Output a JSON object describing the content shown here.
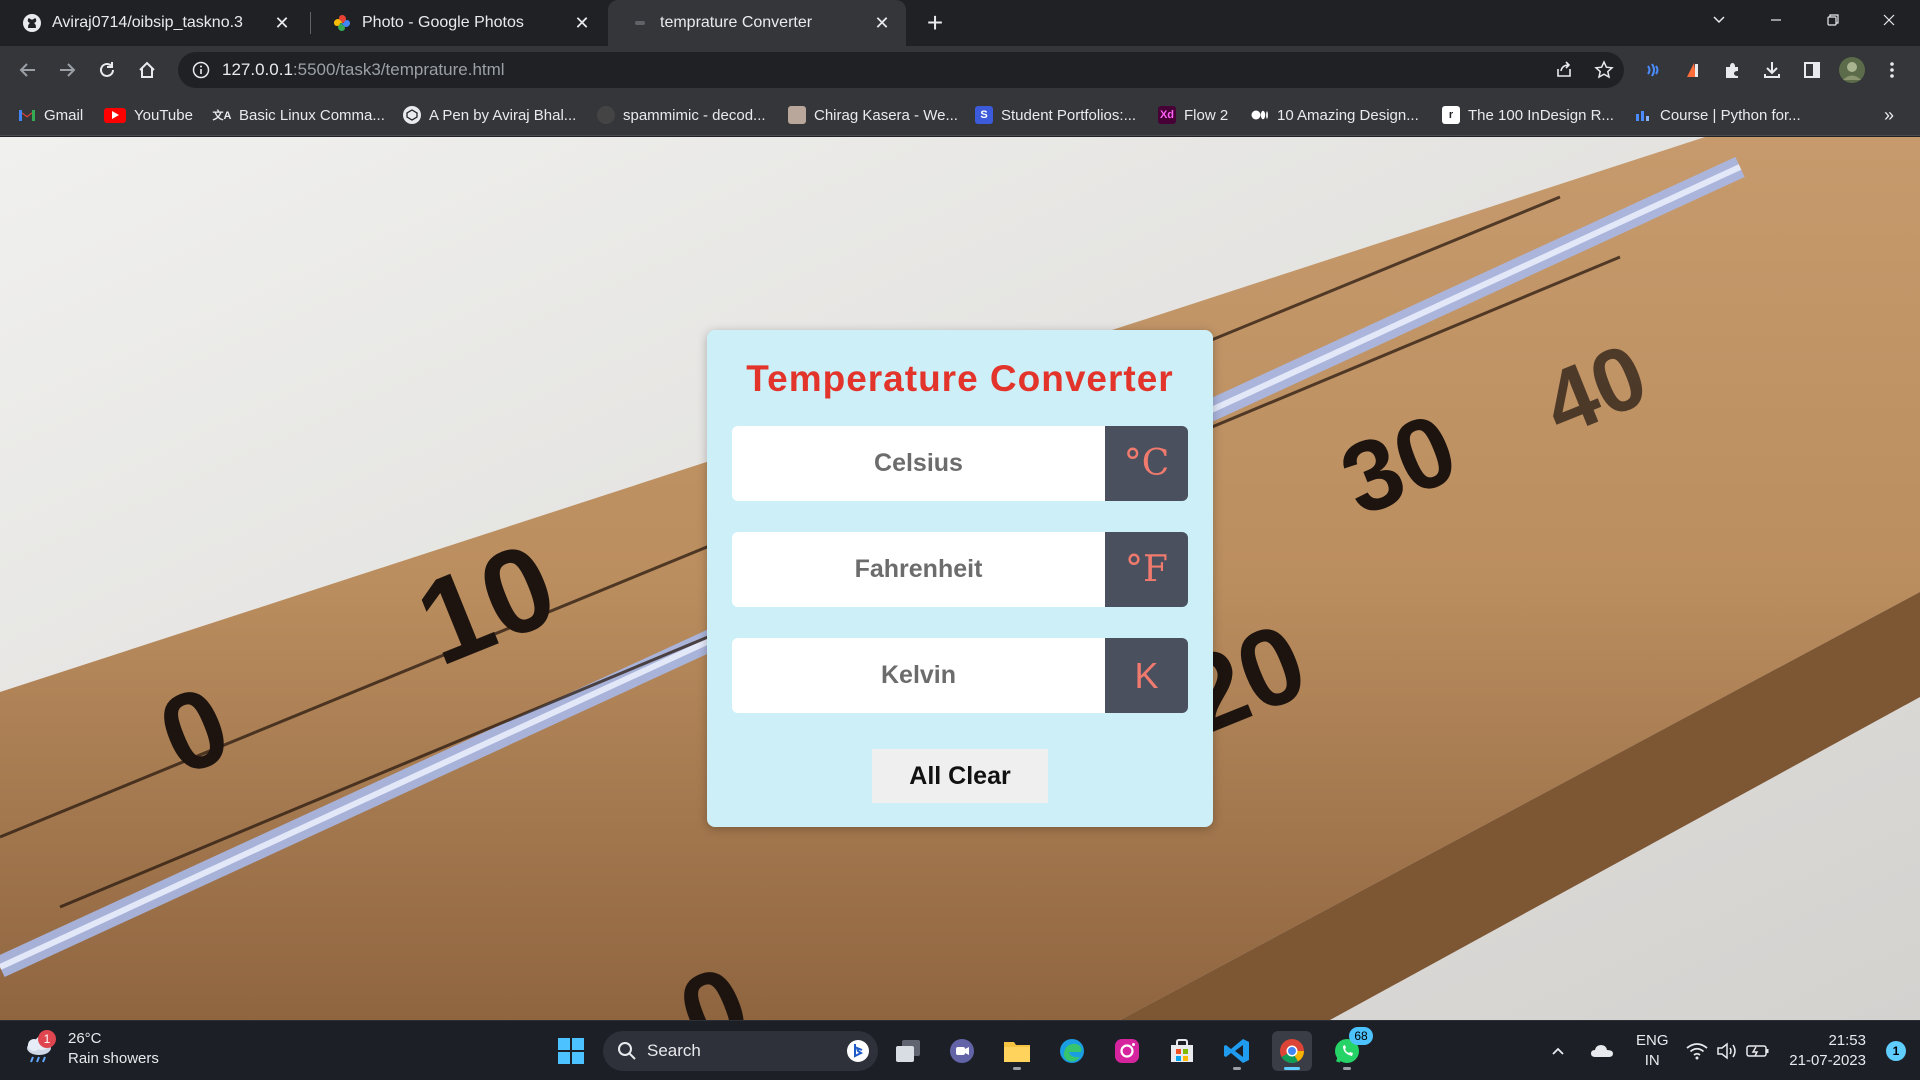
{
  "browser": {
    "tabs": [
      {
        "title": "Aviraj0714/oibsip_taskno.3",
        "icon": "github-icon",
        "active": false
      },
      {
        "title": "Photo - Google Photos",
        "icon": "google-photos-icon",
        "active": false
      },
      {
        "title": "temprature Converter",
        "icon": "page-icon",
        "active": true
      }
    ],
    "url_host": "127.0.0.1",
    "url_path": ":5500/task3/temprature.html",
    "bookmarks": [
      {
        "label": "Gmail",
        "icon": "gmail-icon"
      },
      {
        "label": "YouTube",
        "icon": "youtube-icon"
      },
      {
        "label": "Basic Linux Comma...",
        "icon": "translate-icon"
      },
      {
        "label": "A Pen by Aviraj Bhal...",
        "icon": "codepen-icon"
      },
      {
        "label": "spammimic - decod...",
        "icon": "spammimic-icon"
      },
      {
        "label": "Chirag Kasera - We...",
        "icon": "portrait-icon"
      },
      {
        "label": "Student Portfolios:...",
        "icon": "s-icon"
      },
      {
        "label": "Flow 2",
        "icon": "xd-icon"
      },
      {
        "label": "10 Amazing Design...",
        "icon": "medium-icon"
      },
      {
        "label": "The 100 InDesign R...",
        "icon": "r-icon"
      },
      {
        "label": "Course | Python for...",
        "icon": "course-icon"
      }
    ],
    "bookmarks_overflow": "»"
  },
  "converter": {
    "title": "Temperature Converter",
    "fields": [
      {
        "placeholder": "Celsius",
        "unit": "°C"
      },
      {
        "placeholder": "Fahrenheit",
        "unit": "°F"
      },
      {
        "placeholder": "Kelvin",
        "unit": "K"
      }
    ],
    "clear_label": "All Clear",
    "colors": {
      "title": "#e3342b",
      "panel": "#cdf0f8",
      "unit_bg": "#4a505e",
      "unit_text": "#f07a6e"
    }
  },
  "taskbar": {
    "weather_temp": "26°C",
    "weather_desc": "Rain showers",
    "weather_badge": "1",
    "search_label": "Search",
    "whatsapp_badge": "68",
    "lang_top": "ENG",
    "lang_bottom": "IN",
    "time": "21:53",
    "date": "21-07-2023",
    "notification_count": "1"
  }
}
